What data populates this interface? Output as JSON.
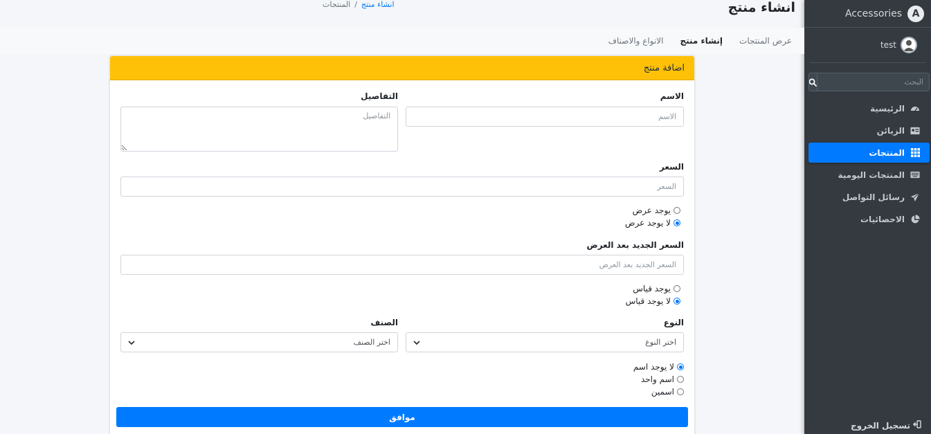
{
  "sidebar": {
    "brand": "Accessories",
    "user": "test",
    "search_placeholder": "البحث",
    "items": [
      {
        "label": "الرئيسية",
        "icon": "dashboard-icon"
      },
      {
        "label": "الزبائن",
        "icon": "id-card-icon"
      },
      {
        "label": "المنتجات",
        "icon": "grid-icon",
        "active": true
      },
      {
        "label": "المنتجات اليومية",
        "icon": "keyboard-icon"
      },
      {
        "label": "رسائل التواصل",
        "icon": "paper-plane-icon"
      },
      {
        "label": "الاحصائيات",
        "icon": "pie-chart-icon"
      }
    ],
    "logout": "تسجيل الخروج"
  },
  "header": {
    "title": "انشاء منتج",
    "breadcrumb": {
      "parent": "المنتجات",
      "separator": "/",
      "current": "انشاء منتج"
    }
  },
  "topnav": {
    "items": [
      "عرض المنتجات",
      "إنشاء منتج",
      "الانواع والاصناف"
    ]
  },
  "form": {
    "header": "اضافة منتج",
    "name_label": "الاسم",
    "name_placeholder": "الاسم",
    "details_label": "التفاصيل",
    "details_placeholder": "التفاصيل",
    "price_label": "السعر",
    "price_placeholder": "السعر",
    "offer_yes": "يوجد عرض",
    "offer_no": "لا يوجد عرض",
    "new_price_label": "السعر الجديد بعد العرض",
    "new_price_placeholder": "السعر الجديد بعد العرض",
    "size_yes": "يوجد قياس",
    "size_no": "لا يوجد قياس",
    "type_label": "النوع",
    "type_select": "اختر النوع",
    "category_label": "الصنف",
    "category_select": "اختر الصنف",
    "names_none": "لا يوجد اسم",
    "names_one": "اسم واحد",
    "names_two": "اسمين",
    "submit": "موافق"
  },
  "colors": {
    "accent": "#007bff",
    "warning": "#ffc107",
    "sidebar": "#343a40"
  }
}
